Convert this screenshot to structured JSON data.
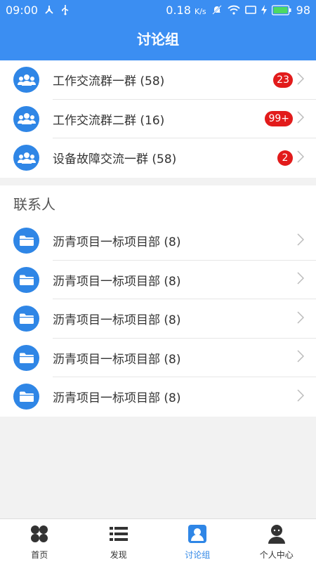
{
  "status_bar": {
    "time": "09:00",
    "speed": "0.18",
    "speed_unit": "K/s",
    "battery": "98"
  },
  "header": {
    "title": "讨论组"
  },
  "groups": [
    {
      "label": "工作交流群一群 (58)",
      "badge": "23"
    },
    {
      "label": "工作交流群二群 (16)",
      "badge": "99+"
    },
    {
      "label": "设备故障交流一群 (58)",
      "badge": "2"
    }
  ],
  "contacts": {
    "title": "联系人",
    "items": [
      {
        "label": "沥青项目一标项目部 (8)"
      },
      {
        "label": "沥青项目一标项目部 (8)"
      },
      {
        "label": "沥青项目一标项目部 (8)"
      },
      {
        "label": "沥青项目一标项目部 (8)"
      },
      {
        "label": "沥青项目一标项目部 (8)"
      }
    ]
  },
  "tabbar": {
    "items": [
      {
        "label": "首页",
        "icon": "grid-icon"
      },
      {
        "label": "发现",
        "icon": "list-icon"
      },
      {
        "label": "讨论组",
        "icon": "contact-card-icon",
        "active": true
      },
      {
        "label": "个人中心",
        "icon": "person-icon"
      }
    ]
  },
  "colors": {
    "primary": "#3b8ef2",
    "badge": "#e21b1b",
    "active_tab": "#2f86e6"
  }
}
